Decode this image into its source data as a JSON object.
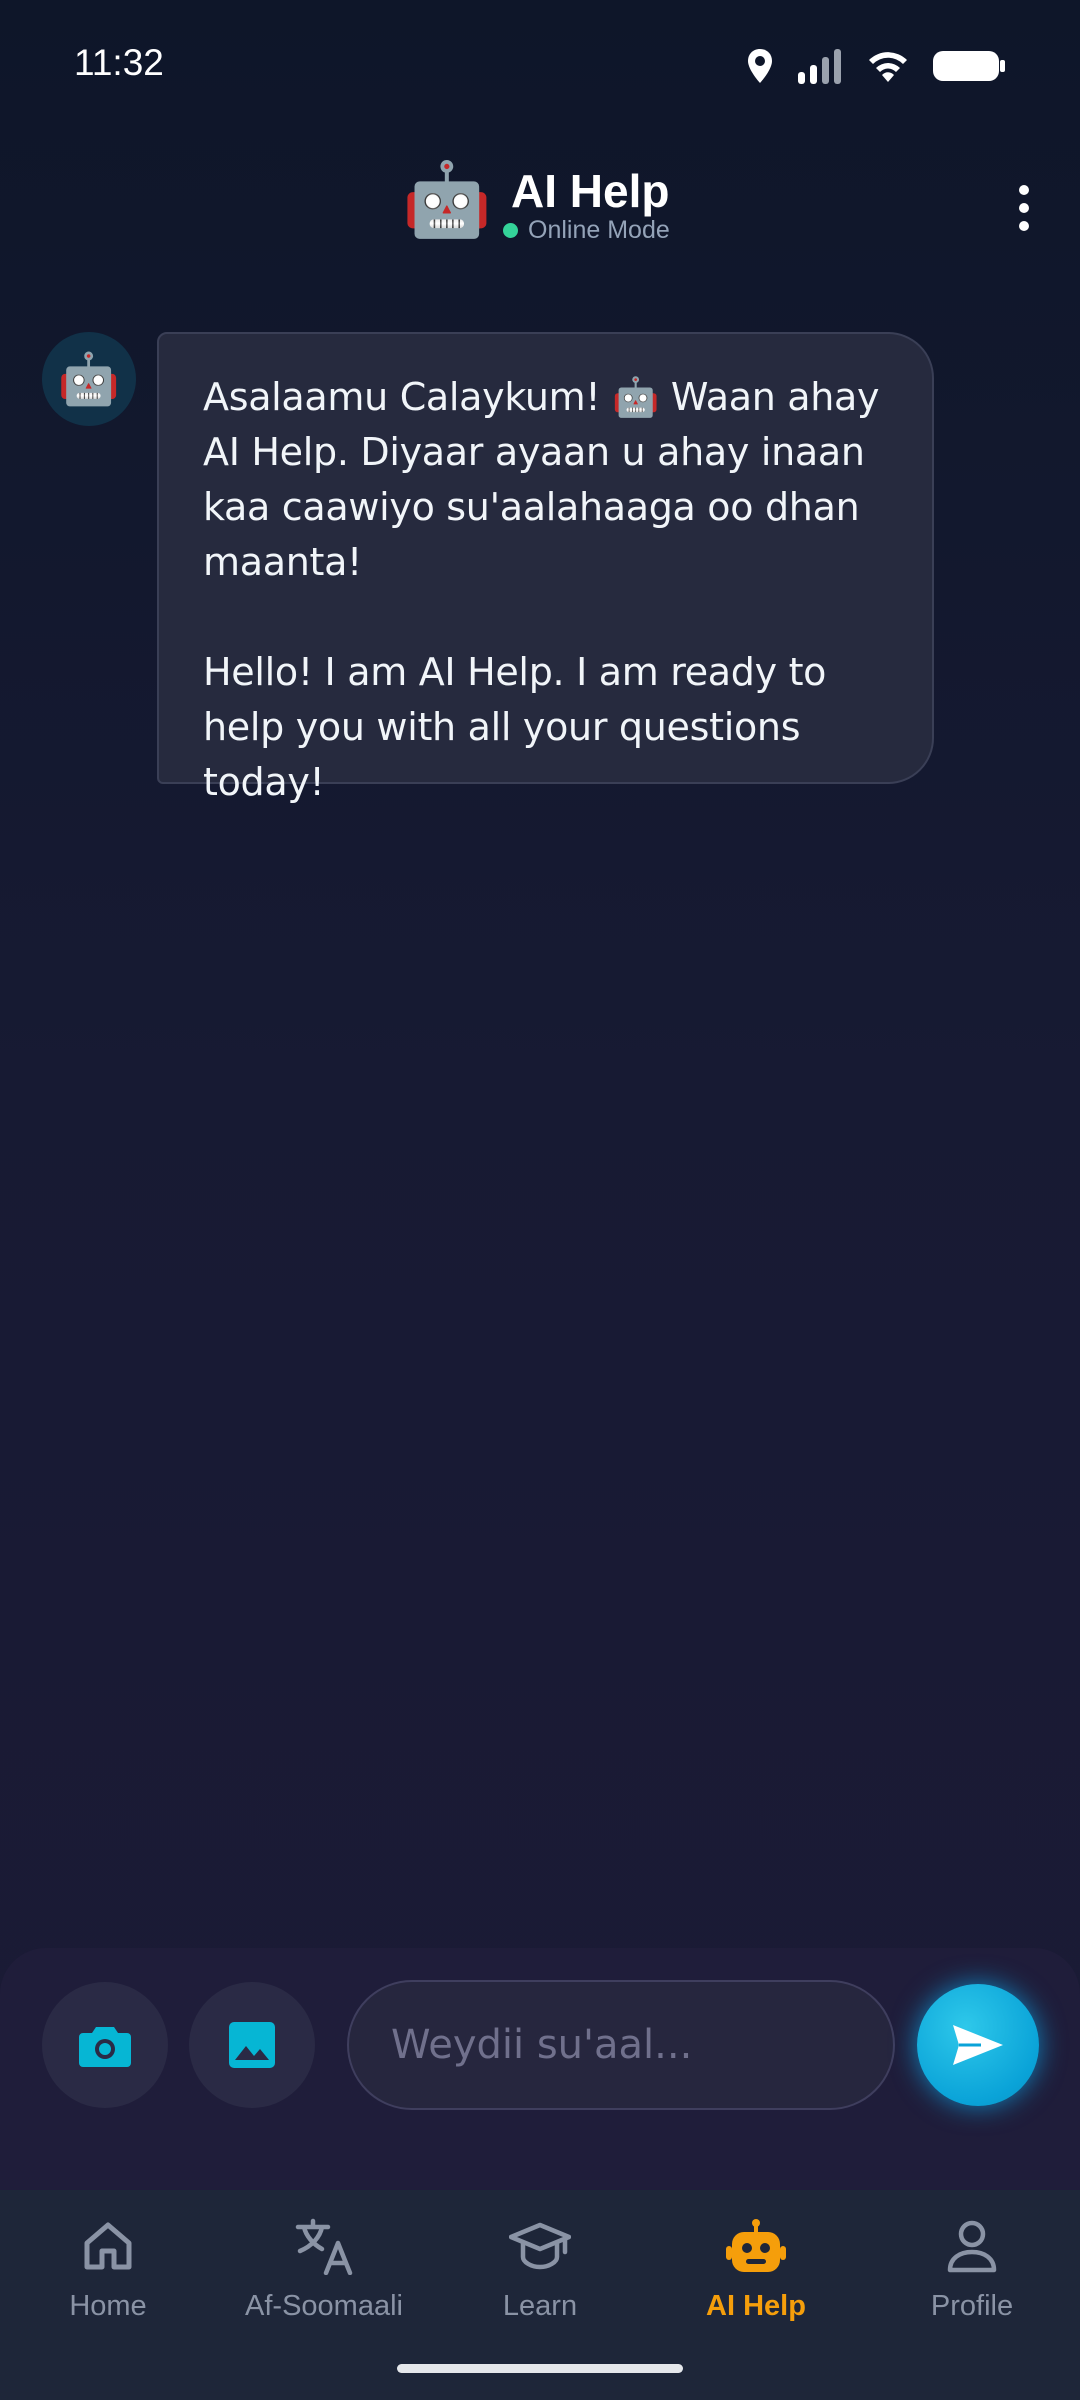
{
  "status_bar": {
    "time": "11:32",
    "icons": [
      "location-icon",
      "signal-icon",
      "wifi-icon",
      "battery-icon"
    ]
  },
  "header": {
    "avatar_emoji": "🤖",
    "title": "AI Help",
    "status_text": "Online Mode",
    "status_color": "#34d399",
    "menu_icon": "more-vertical-icon"
  },
  "chat": {
    "messages": [
      {
        "sender": "bot",
        "avatar_emoji": "🤖",
        "paragraph_1": "Asalaamu Calaykum! 🤖 Waan ahay AI Help. Diyaar ayaan u ahay inaan kaa caawiyo su'aalahaaga oo dhan maanta!",
        "paragraph_2": "Hello! I am AI Help. I am ready to help you with all your questions today!"
      }
    ]
  },
  "composer": {
    "input_placeholder": "Weydii su'aal...",
    "input_value": "",
    "camera_icon": "camera-icon",
    "gallery_icon": "image-icon",
    "send_icon": "send-icon",
    "accent_color": "#06b6d4"
  },
  "nav": {
    "active_color": "#f59e0b",
    "items": [
      {
        "label": "Home",
        "icon": "home-icon"
      },
      {
        "label": "Af-Soomaali",
        "icon": "translate-icon"
      },
      {
        "label": "Learn",
        "icon": "graduation-cap-icon"
      },
      {
        "label": "AI Help",
        "icon": "robot-icon",
        "active": true
      },
      {
        "label": "Profile",
        "icon": "user-icon"
      }
    ]
  }
}
